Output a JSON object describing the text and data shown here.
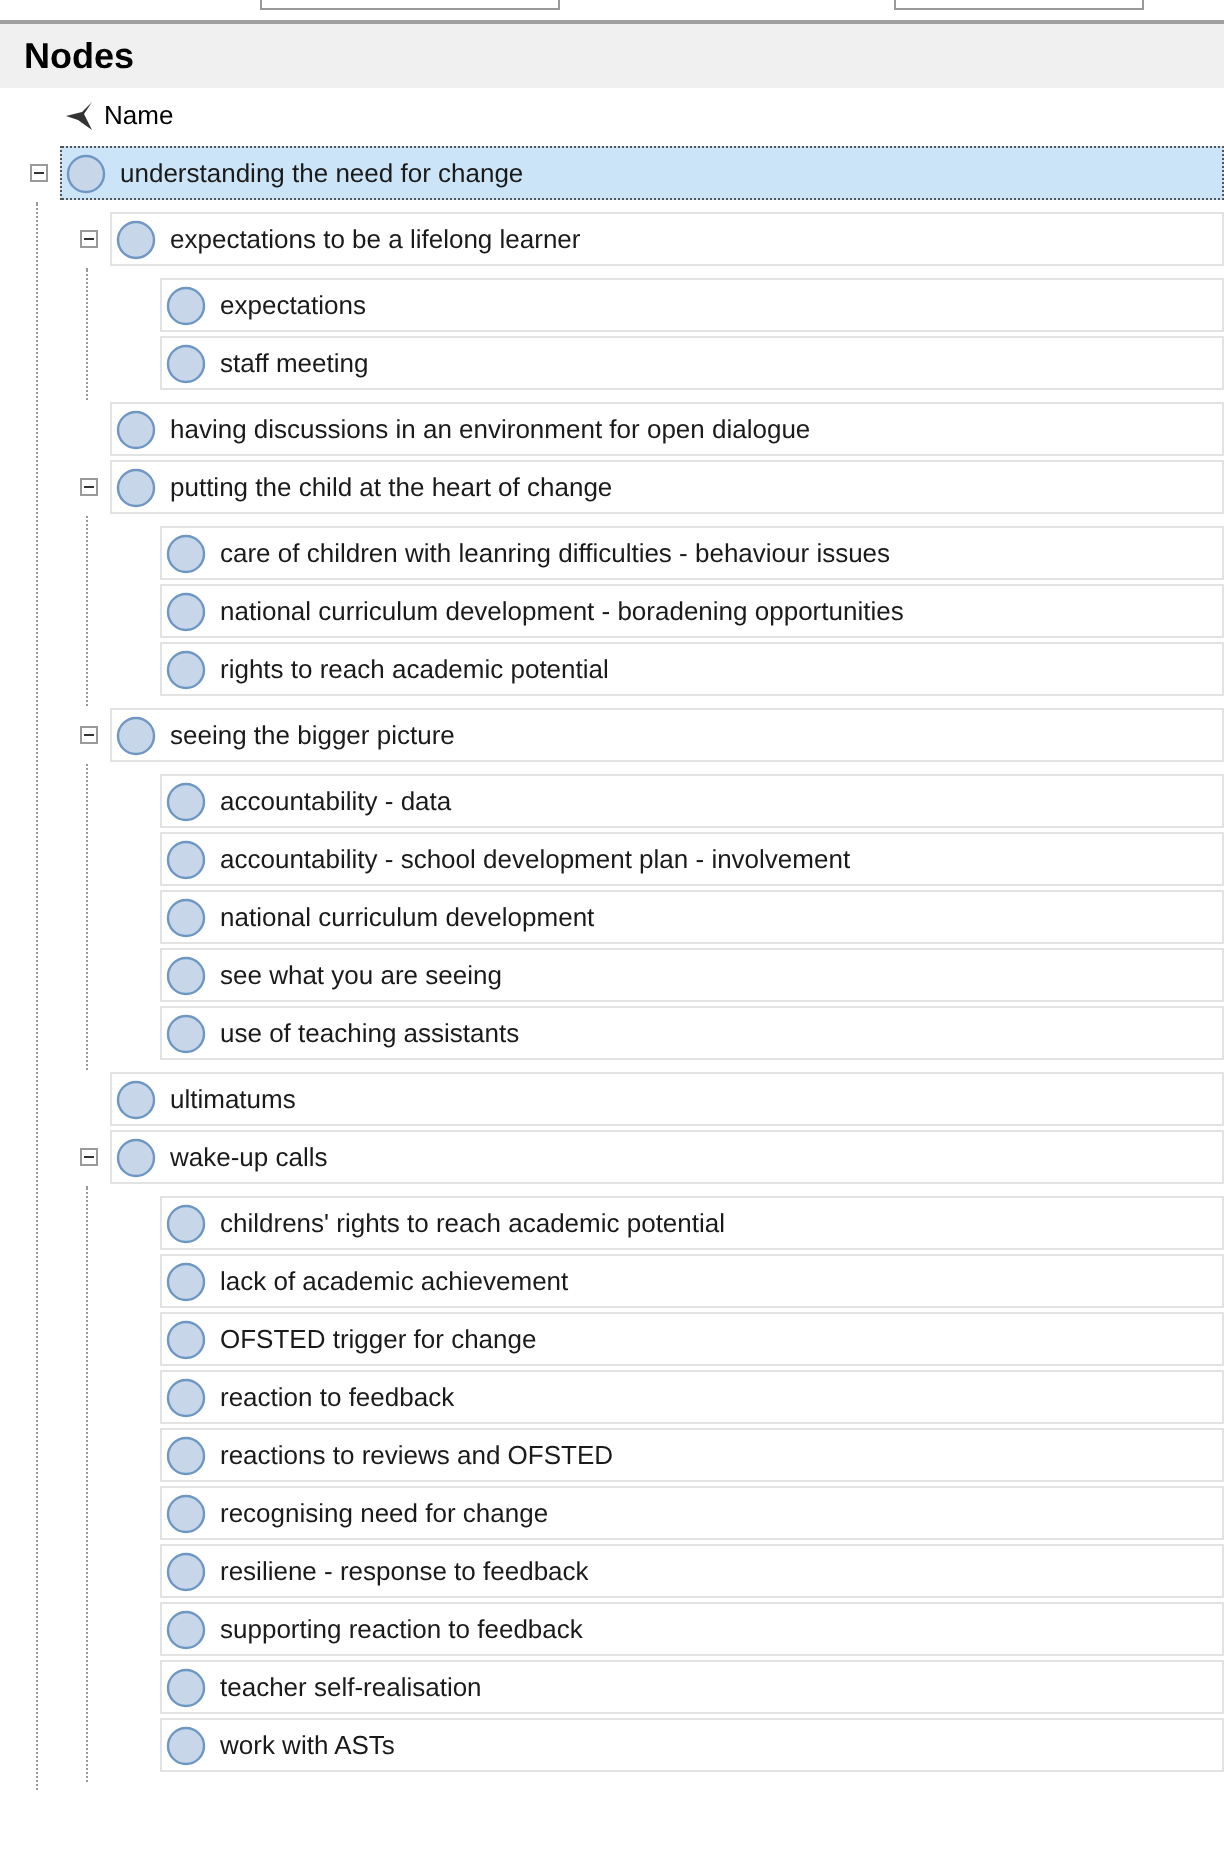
{
  "panel": {
    "title": "Nodes"
  },
  "columns": [
    {
      "label": "Name"
    }
  ],
  "nodes": [
    {
      "name": "understanding the need for change",
      "selected": true,
      "expanded": true,
      "children": [
        {
          "name": "expectations to be a lifelong learner",
          "selected": false,
          "expanded": true,
          "children": [
            {
              "name": "expectations",
              "selected": false
            },
            {
              "name": "staff meeting",
              "selected": false
            }
          ]
        },
        {
          "name": "having discussions in an environment for open dialogue",
          "selected": false
        },
        {
          "name": "putting the child at the heart of change",
          "selected": false,
          "expanded": true,
          "children": [
            {
              "name": "care of children with leanring difficulties - behaviour issues",
              "selected": false
            },
            {
              "name": "national curriculum development - boradening opportunities",
              "selected": false
            },
            {
              "name": "rights to reach academic potential",
              "selected": false
            }
          ]
        },
        {
          "name": "seeing the bigger picture",
          "selected": false,
          "expanded": true,
          "children": [
            {
              "name": "accountability - data",
              "selected": false
            },
            {
              "name": "accountability - school development plan - involvement",
              "selected": false
            },
            {
              "name": "national curriculum development",
              "selected": false
            },
            {
              "name": "see what you are seeing",
              "selected": false
            },
            {
              "name": "use of teaching assistants",
              "selected": false
            }
          ]
        },
        {
          "name": "ultimatums",
          "selected": false
        },
        {
          "name": "wake-up calls",
          "selected": false,
          "expanded": true,
          "children": [
            {
              "name": "childrens' rights to reach academic potential",
              "selected": false
            },
            {
              "name": "lack of academic achievement",
              "selected": false
            },
            {
              "name": "OFSTED trigger for change",
              "selected": false
            },
            {
              "name": "reaction to feedback",
              "selected": false
            },
            {
              "name": "reactions to reviews and OFSTED",
              "selected": false
            },
            {
              "name": "recognising need for change",
              "selected": false
            },
            {
              "name": "resiliene - response to feedback",
              "selected": false
            },
            {
              "name": "supporting reaction to feedback",
              "selected": false
            },
            {
              "name": "teacher self-realisation",
              "selected": false
            },
            {
              "name": "work with ASTs",
              "selected": false
            }
          ]
        }
      ]
    }
  ]
}
